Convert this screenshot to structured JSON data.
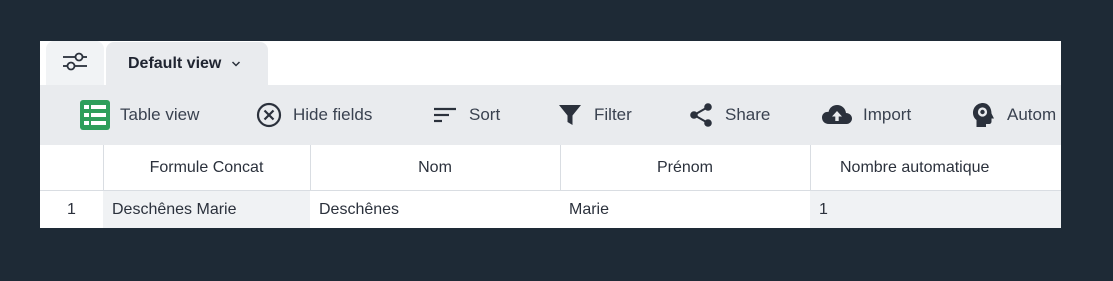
{
  "tabs": {
    "active_label": "Default view"
  },
  "toolbar": {
    "items": [
      {
        "label": "Table view",
        "icon": "table-view-icon",
        "color": "#2e9e5b"
      },
      {
        "label": "Hide fields",
        "icon": "hide-fields-icon"
      },
      {
        "label": "Sort",
        "icon": "sort-icon"
      },
      {
        "label": "Filter",
        "icon": "filter-icon"
      },
      {
        "label": "Share",
        "icon": "share-icon"
      },
      {
        "label": "Import",
        "icon": "cloud-upload-icon"
      },
      {
        "label": "Autom",
        "icon": "automation-icon"
      }
    ]
  },
  "grid": {
    "columns": [
      "",
      "Formule Concat",
      "Nom",
      "Prénom",
      "Nombre automatique"
    ],
    "rows": [
      {
        "index": "1",
        "cells": [
          "Deschênes Marie",
          "Deschênes",
          "Marie",
          "1"
        ]
      }
    ]
  }
}
